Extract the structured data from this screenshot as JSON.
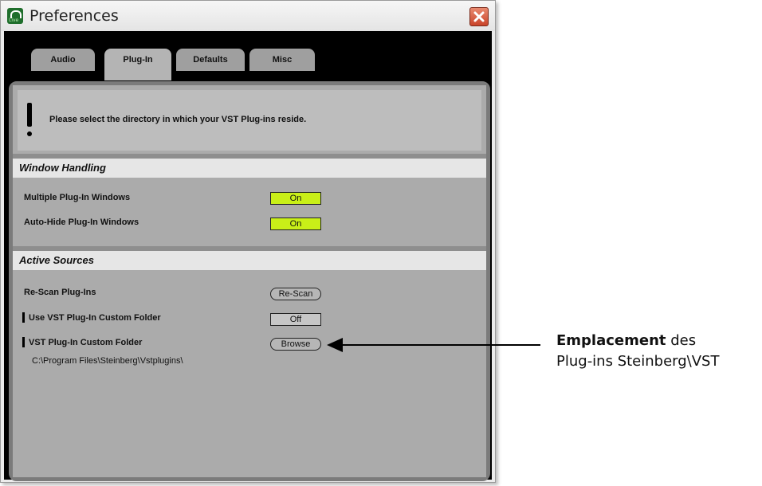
{
  "window": {
    "title": "Preferences",
    "app_icon_text": "Live"
  },
  "tabs": [
    {
      "label": "Audio",
      "active": false
    },
    {
      "label": "Plug-In",
      "active": true
    },
    {
      "label": "Defaults",
      "active": false
    },
    {
      "label": "Misc",
      "active": false
    }
  ],
  "info": {
    "text": "Please select the directory in which your VST Plug-ins reside."
  },
  "window_handling": {
    "heading": "Window Handling",
    "rows": [
      {
        "label": "Multiple Plug-In Windows",
        "value": "On"
      },
      {
        "label": "Auto-Hide Plug-In Windows",
        "value": "On"
      }
    ]
  },
  "active_sources": {
    "heading": "Active Sources",
    "rescan": {
      "label": "Re-Scan Plug-Ins",
      "button": "Re-Scan"
    },
    "custom_folder_toggle": {
      "label": "Use VST Plug-In Custom Folder",
      "value": "Off"
    },
    "custom_folder": {
      "label": "VST Plug-In Custom Folder",
      "button": "Browse",
      "path": "C:\\Program Files\\Steinberg\\Vstplugins\\"
    }
  },
  "annotation": {
    "bold": "Emplacement",
    "rest_line1": " des",
    "line2": "Plug-ins Steinberg\\VST"
  },
  "colors": {
    "toggle_on": "#c9ef18",
    "close_button": "#c9442a",
    "panel": "#ababab"
  }
}
